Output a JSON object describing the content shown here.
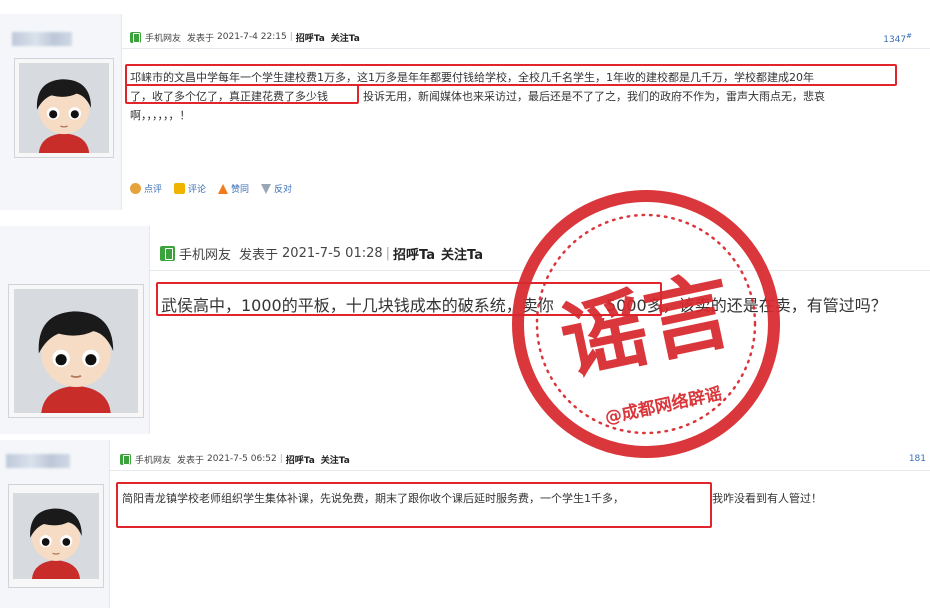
{
  "posts": [
    {
      "author": "手机网友",
      "posted_prefix": "发表于",
      "posted_time": "2021-7-4 22:15",
      "greet": "招呼Ta",
      "follow": "关注Ta",
      "floor": "1347",
      "floor_suffix": "#",
      "line1": "邛崃市的文昌中学每年一个学生建校费1万多，这1万多是年年都要付钱给学校，全校几千名学生，1年收的建校都是几千万，学校都建成20年",
      "line2a": "了，收了多个亿了，真正建花费了多少钱",
      "line2b": "投诉无用，新闻媒体也来采访过，最后还是不了了之，我们的政府不作为，雷声大雨点无，悲哀",
      "line3": "啊，，，，，，！",
      "actions": [
        "点评",
        "评论",
        "赞同",
        "反对"
      ]
    },
    {
      "author": "手机网友",
      "posted_prefix": "发表于",
      "posted_time": "2021-7-5 01:28",
      "greet": "招呼Ta",
      "follow": "关注Ta",
      "text_a": "武侯高中，1000的平板，十几块钱成本的破系统，卖你",
      "text_b": "5000多，该卖的还是在卖，有管过吗？"
    },
    {
      "author": "手机网友",
      "posted_prefix": "发表于",
      "posted_time": "2021-7-5 06:52",
      "greet": "招呼Ta",
      "follow": "关注Ta",
      "floor": "181",
      "text_a": "简阳青龙镇学校老师组织学生集体补课，先说免费，期末了跟你收个课后延时服务费，一个学生1千多，",
      "text_b": "我咋没看到有人管过！"
    }
  ],
  "stamp": {
    "title": "谣言",
    "caption": "@成都网络辟谣",
    "color": "#d8282e"
  },
  "colors": {
    "highlight": "#e0262a",
    "link": "#3a6fb7",
    "author_icon": "#3ca33c"
  }
}
